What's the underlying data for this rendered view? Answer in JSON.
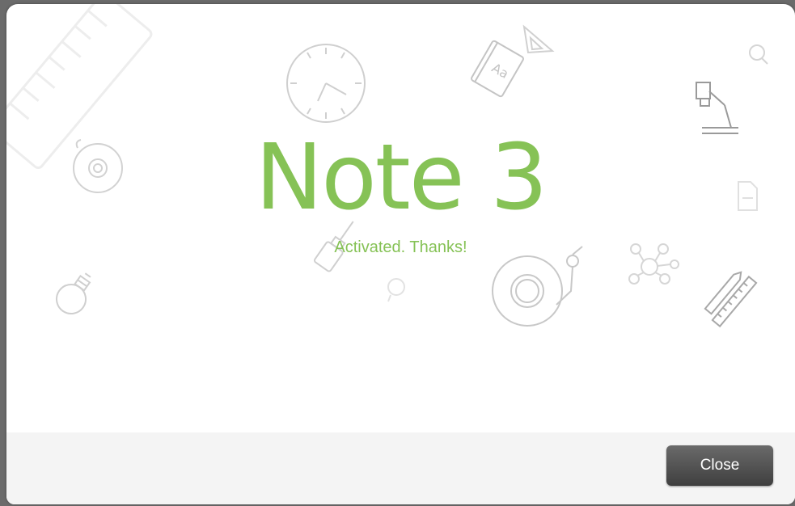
{
  "dialog": {
    "product_title": "Note 3",
    "message": "Activated. Thanks!",
    "close_label": "Close"
  },
  "colors": {
    "accent_green": "#86c256",
    "doodle_gray": "#c9c9c9",
    "button_dark": "#4a4a4a",
    "footer_bg": "#f4f4f4"
  },
  "background_icons": [
    "ruler-icon",
    "clock-icon",
    "dictionary-book-icon",
    "set-square-icon",
    "magnifier-icon",
    "desk-lamp-icon",
    "disc-icon",
    "document-icon",
    "lightbulb-icon",
    "usb-drive-icon",
    "lightbulb-small-icon",
    "record-player-icon",
    "molecule-icon",
    "pencil-ruler-icon"
  ]
}
